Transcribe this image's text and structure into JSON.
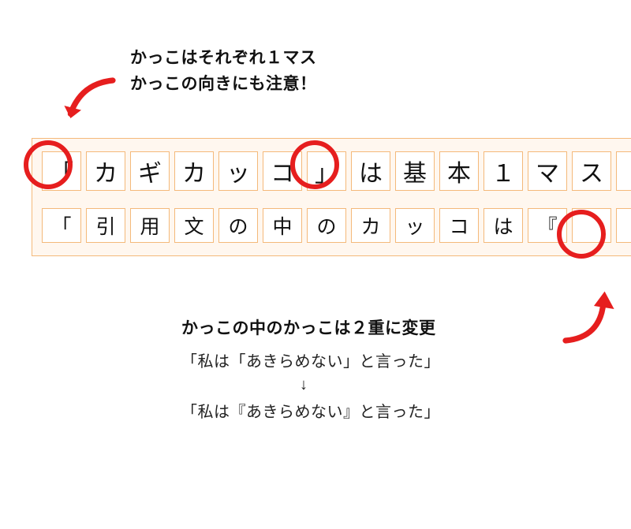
{
  "top_caption": {
    "line1": "かっこはそれぞれ１マス",
    "line2": "かっこの向きにも注意！"
  },
  "grid": {
    "row1": [
      "「",
      "カ",
      "ギ",
      "カ",
      "ッ",
      "コ",
      "」",
      "は",
      "基",
      "本",
      "１",
      "マ",
      "ス"
    ],
    "row2": [
      "「",
      "引",
      "用",
      "文",
      "の",
      "中",
      "の",
      "カ",
      "ッ",
      "コ",
      "は",
      "『",
      ""
    ]
  },
  "bottom": {
    "title": "かっこの中のかっこは２重に変更",
    "example_before": "「私は「あきらめない」と言った」",
    "arrow": "↓",
    "example_after": "「私は『あきらめない』と言った」"
  },
  "colors": {
    "accent_red": "#e61e1e",
    "grid_border": "#f4b97a"
  }
}
